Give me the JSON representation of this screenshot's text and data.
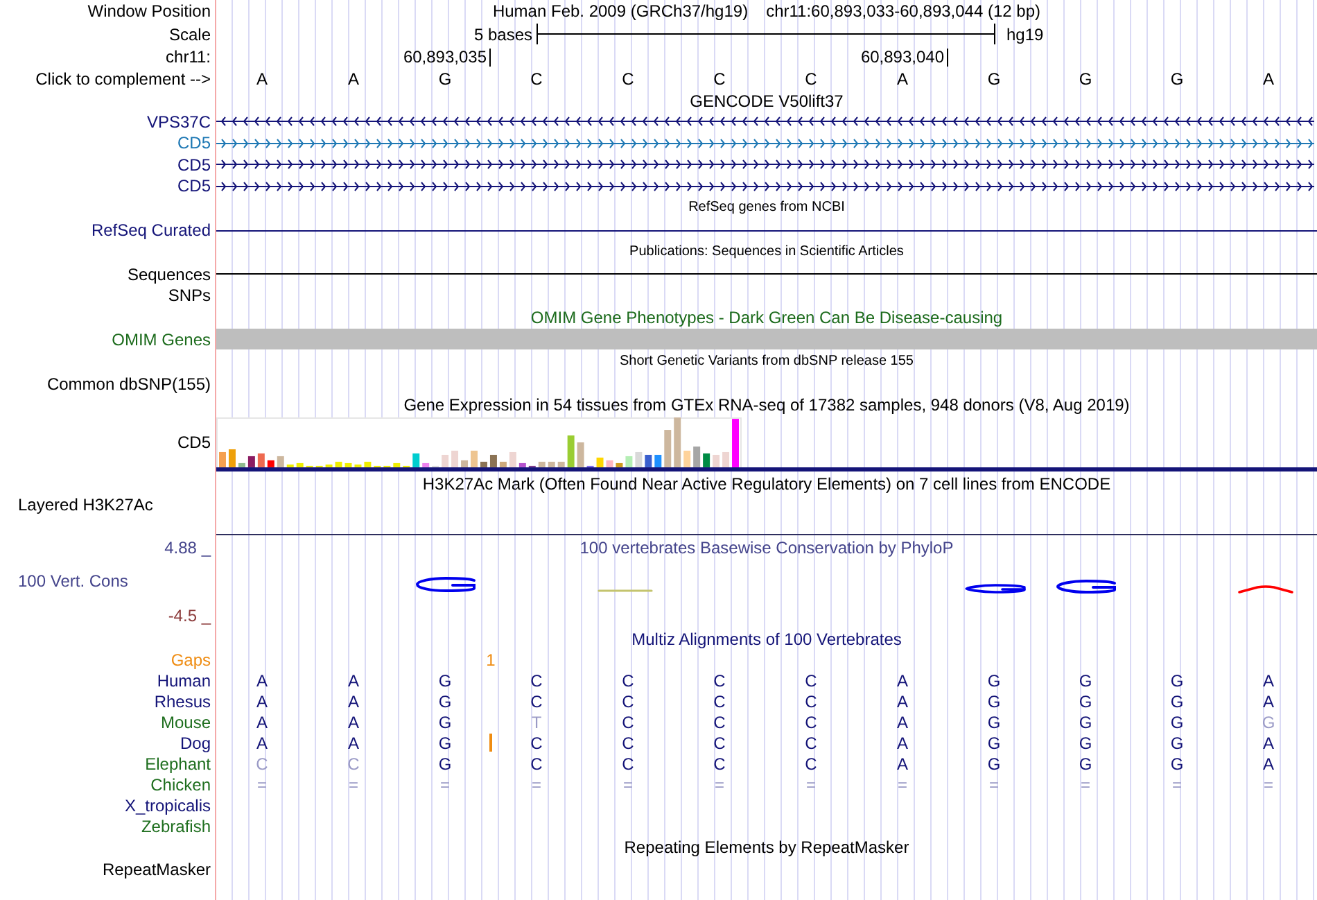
{
  "header": {
    "label": "Window Position",
    "assembly": "Human Feb. 2009 (GRCh37/hg19)",
    "position": "chr11:60,893,033-60,893,044 (12 bp)"
  },
  "scale": {
    "label": "Scale",
    "bar_label": "5 bases",
    "genome": "hg19"
  },
  "ruler": {
    "label": "chr11:",
    "ticks": [
      "60,893,035",
      "60,893,040"
    ]
  },
  "sequence": {
    "label": "Click to complement -->",
    "bases": [
      "A",
      "A",
      "G",
      "C",
      "C",
      "C",
      "C",
      "A",
      "G",
      "G",
      "G",
      "A"
    ]
  },
  "tracks": [
    {
      "kind": "genes",
      "title": "GENCODE V50lift37",
      "genes": [
        {
          "name": "VPS37C",
          "reverse": true,
          "color": "#141478"
        },
        {
          "name": "CD5",
          "reverse": false,
          "color": "#1e78b4"
        },
        {
          "name": "CD5",
          "reverse": false,
          "color": "#141478"
        },
        {
          "name": "CD5",
          "reverse": false,
          "color": "#141478"
        }
      ]
    },
    {
      "kind": "line",
      "title": "RefSeq genes from NCBI",
      "label": "RefSeq Curated",
      "color": "#141478"
    },
    {
      "kind": "line",
      "title": "Publications: Sequences in Scientific Articles",
      "label": "Sequences",
      "color": "#000000",
      "sublabel": "SNPs"
    },
    {
      "kind": "bar",
      "title": "OMIM Gene Phenotypes - Dark Green Can Be Disease-causing",
      "label": "OMIM Genes"
    },
    {
      "kind": "variants",
      "title": "Short Genetic Variants from dbSNP release 155",
      "label": "Common dbSNP(155)"
    },
    {
      "kind": "expression",
      "title": "Gene Expression in 54 tissues from GTEx RNA-seq of 17382 samples, 948 donors (V8, Aug 2019)",
      "label": "CD5"
    },
    {
      "kind": "signal",
      "title": "H3K27Ac Mark (Often Found Near Active Regulatory Elements) on 7 cell lines from ENCODE",
      "label": "Layered H3K27Ac"
    },
    {
      "kind": "conservation",
      "title": "100 vertebrates Basewise Conservation by PhyloP",
      "label": "100 Vert. Cons",
      "axis_max": "4.88 _",
      "axis_min": "-4.5 _"
    },
    {
      "kind": "alignment",
      "title": "Multiz Alignments of 100 Vertebrates",
      "gaps": {
        "label": "Gaps",
        "marks": [
          "1"
        ]
      },
      "species": [
        {
          "name": "Human",
          "color": "#141478",
          "bases": [
            {
              "base": "A",
              "match": true,
              "insertion": false
            },
            {
              "base": "A",
              "match": true,
              "insertion": false
            },
            {
              "base": "G",
              "match": true,
              "insertion": false
            },
            {
              "base": "C",
              "match": true,
              "insertion": false
            },
            {
              "base": "C",
              "match": true,
              "insertion": false
            },
            {
              "base": "C",
              "match": true,
              "insertion": false
            },
            {
              "base": "C",
              "match": true,
              "insertion": false
            },
            {
              "base": "A",
              "match": true,
              "insertion": false
            },
            {
              "base": "G",
              "match": true,
              "insertion": false
            },
            {
              "base": "G",
              "match": true,
              "insertion": false
            },
            {
              "base": "G",
              "match": true,
              "insertion": false
            },
            {
              "base": "A",
              "match": true,
              "insertion": false
            }
          ]
        },
        {
          "name": "Rhesus",
          "color": "#141478",
          "bases": [
            {
              "base": "A",
              "match": true,
              "insertion": false
            },
            {
              "base": "A",
              "match": true,
              "insertion": false
            },
            {
              "base": "G",
              "match": true,
              "insertion": false
            },
            {
              "base": "C",
              "match": true,
              "insertion": false
            },
            {
              "base": "C",
              "match": true,
              "insertion": false
            },
            {
              "base": "C",
              "match": true,
              "insertion": false
            },
            {
              "base": "C",
              "match": true,
              "insertion": false
            },
            {
              "base": "A",
              "match": true,
              "insertion": false
            },
            {
              "base": "G",
              "match": true,
              "insertion": false
            },
            {
              "base": "G",
              "match": true,
              "insertion": false
            },
            {
              "base": "G",
              "match": true,
              "insertion": false
            },
            {
              "base": "A",
              "match": true,
              "insertion": false
            }
          ]
        },
        {
          "name": "Mouse",
          "color": "#1e6e1e",
          "bases": [
            {
              "base": "A",
              "match": true,
              "insertion": false
            },
            {
              "base": "A",
              "match": true,
              "insertion": false
            },
            {
              "base": "G",
              "match": true,
              "insertion": false
            },
            {
              "base": "T",
              "match": false,
              "insertion": false
            },
            {
              "base": "C",
              "match": true,
              "insertion": false
            },
            {
              "base": "C",
              "match": true,
              "insertion": false
            },
            {
              "base": "C",
              "match": true,
              "insertion": false
            },
            {
              "base": "A",
              "match": true,
              "insertion": false
            },
            {
              "base": "G",
              "match": true,
              "insertion": false
            },
            {
              "base": "G",
              "match": true,
              "insertion": false
            },
            {
              "base": "G",
              "match": true,
              "insertion": false
            },
            {
              "base": "G",
              "match": false,
              "insertion": false
            }
          ]
        },
        {
          "name": "Dog",
          "color": "#141478",
          "bases": [
            {
              "base": "A",
              "match": true,
              "insertion": false
            },
            {
              "base": "A",
              "match": true,
              "insertion": false
            },
            {
              "base": "G",
              "match": true,
              "insertion": true
            },
            {
              "base": "C",
              "match": true,
              "insertion": false
            },
            {
              "base": "C",
              "match": true,
              "insertion": false
            },
            {
              "base": "C",
              "match": true,
              "insertion": false
            },
            {
              "base": "C",
              "match": true,
              "insertion": false
            },
            {
              "base": "A",
              "match": true,
              "insertion": false
            },
            {
              "base": "G",
              "match": true,
              "insertion": false
            },
            {
              "base": "G",
              "match": true,
              "insertion": false
            },
            {
              "base": "G",
              "match": true,
              "insertion": false
            },
            {
              "base": "A",
              "match": true,
              "insertion": false
            }
          ]
        },
        {
          "name": "Elephant",
          "color": "#1e6e1e",
          "bases": [
            {
              "base": "C",
              "match": false,
              "insertion": false
            },
            {
              "base": "C",
              "match": false,
              "insertion": false
            },
            {
              "base": "G",
              "match": true,
              "insertion": false
            },
            {
              "base": "C",
              "match": true,
              "insertion": false
            },
            {
              "base": "C",
              "match": true,
              "insertion": false
            },
            {
              "base": "C",
              "match": true,
              "insertion": false
            },
            {
              "base": "C",
              "match": true,
              "insertion": false
            },
            {
              "base": "A",
              "match": true,
              "insertion": false
            },
            {
              "base": "G",
              "match": true,
              "insertion": false
            },
            {
              "base": "G",
              "match": true,
              "insertion": false
            },
            {
              "base": "G",
              "match": true,
              "insertion": false
            },
            {
              "base": "A",
              "match": true,
              "insertion": false
            }
          ]
        },
        {
          "name": "Chicken",
          "color": "#1e6e1e",
          "bases": [
            {
              "base": "=",
              "match": false,
              "insertion": false
            },
            {
              "base": "=",
              "match": false,
              "insertion": false
            },
            {
              "base": "=",
              "match": false,
              "insertion": false
            },
            {
              "base": "=",
              "match": false,
              "insertion": false
            },
            {
              "base": "=",
              "match": false,
              "insertion": false
            },
            {
              "base": "=",
              "match": false,
              "insertion": false
            },
            {
              "base": "=",
              "match": false,
              "insertion": false
            },
            {
              "base": "=",
              "match": false,
              "insertion": false
            },
            {
              "base": "=",
              "match": false,
              "insertion": false
            },
            {
              "base": "=",
              "match": false,
              "insertion": false
            },
            {
              "base": "=",
              "match": false,
              "insertion": false
            },
            {
              "base": "=",
              "match": false,
              "insertion": false
            }
          ]
        },
        {
          "name": "X_tropicalis",
          "color": "#141478"
        },
        {
          "name": "Zebrafish",
          "color": "#1e6e1e"
        }
      ]
    },
    {
      "kind": "repeats",
      "title": "Repeating Elements by RepeatMasker",
      "label": "RepeatMasker"
    }
  ]
}
